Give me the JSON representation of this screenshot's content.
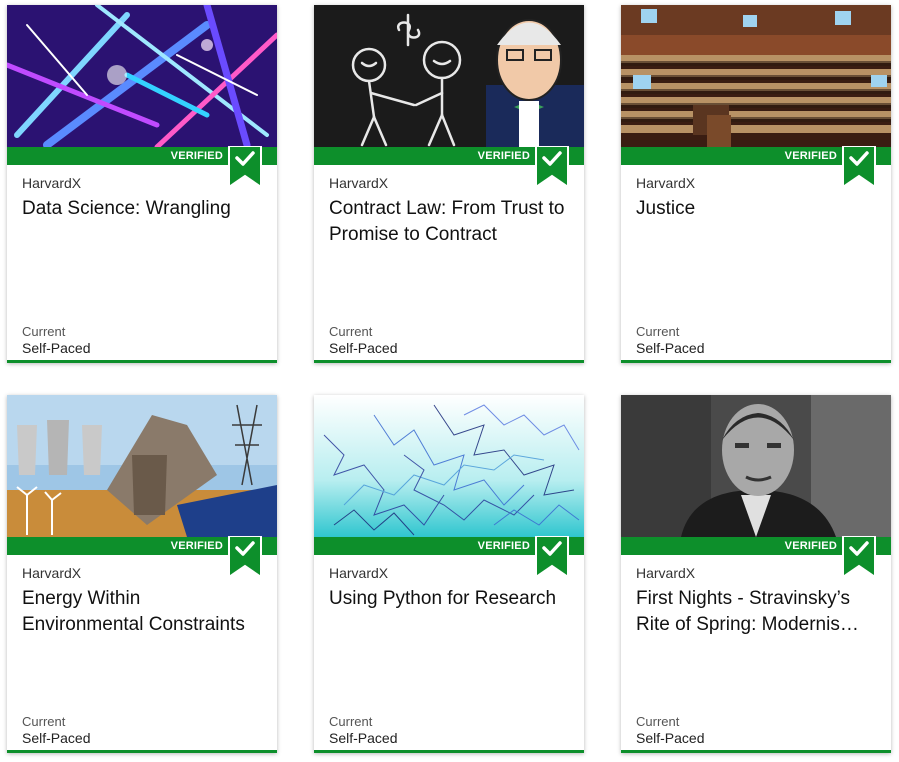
{
  "colors": {
    "accent_green": "#0d8f2b",
    "ribbon_check": "#ffffff"
  },
  "courses": [
    {
      "image_icon": "data-science-neon-structure-image",
      "badge": "VERIFIED",
      "org": "HarvardX",
      "title": "Data Science: Wrangling",
      "status": "Current",
      "pacing": "Self-Paced"
    },
    {
      "image_icon": "contract-law-chalkboard-image",
      "badge": "VERIFIED",
      "org": "HarvardX",
      "title": "Contract Law: From Trust to Promise to Contract",
      "status": "Current",
      "pacing": "Self-Paced"
    },
    {
      "image_icon": "justice-lecture-hall-image",
      "badge": "VERIFIED",
      "org": "HarvardX",
      "title": "Justice",
      "status": "Current",
      "pacing": "Self-Paced"
    },
    {
      "image_icon": "energy-power-plant-collage-image",
      "badge": "VERIFIED",
      "org": "HarvardX",
      "title": "Energy Within Environmental Constraints",
      "status": "Current",
      "pacing": "Self-Paced"
    },
    {
      "image_icon": "python-random-walk-image",
      "badge": "VERIFIED",
      "org": "HarvardX",
      "title": "Using Python for Research",
      "status": "Current",
      "pacing": "Self-Paced"
    },
    {
      "image_icon": "stravinsky-portrait-image",
      "badge": "VERIFIED",
      "org": "HarvardX",
      "title": "First Nights - Stravinsky’s Rite of Spring: Modernis…",
      "status": "Current",
      "pacing": "Self-Paced"
    }
  ]
}
